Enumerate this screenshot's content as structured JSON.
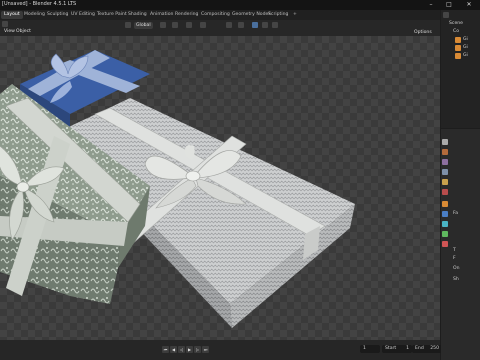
{
  "window": {
    "title": "[Unsaved] - Blender 4.5.1 LTS",
    "minimize": "–",
    "maximize": "□",
    "close": "✕"
  },
  "workspace_tabs": [
    {
      "label": "Layout",
      "active": true
    },
    {
      "label": "Modeling"
    },
    {
      "label": "Sculpting"
    },
    {
      "label": "UV Editing"
    },
    {
      "label": "Texture Paint"
    },
    {
      "label": "Shading"
    },
    {
      "label": "Animation"
    },
    {
      "label": "Rendering"
    },
    {
      "label": "Compositing"
    },
    {
      "label": "Geometry Nodes"
    },
    {
      "label": "Scripting"
    },
    {
      "label": "+"
    }
  ],
  "viewport_header": {
    "menu_view": "View",
    "menu_object": "Object",
    "orientation": "Global",
    "options": "Options"
  },
  "timeline": {
    "start_label": "Start",
    "start_value": "1",
    "end_label": "End",
    "end_value": "250",
    "current_frame": "1"
  },
  "outliner": {
    "search_label": "Scene",
    "rows": [
      "Scene",
      "Co",
      "Gi",
      "Gi",
      "Gi"
    ]
  },
  "properties": {
    "labels": [
      "Fa",
      "T",
      "F",
      "On",
      "Sh"
    ]
  },
  "colors": {
    "accent": "#3f76b6",
    "ribbon": "#c9cbc7",
    "paper_white": "#cfcfcf",
    "paper_blue": "#3b5fa6"
  },
  "scene": {
    "objects": [
      "gift-box-blue",
      "gift-box-patterned",
      "gift-box-zigzag"
    ]
  }
}
